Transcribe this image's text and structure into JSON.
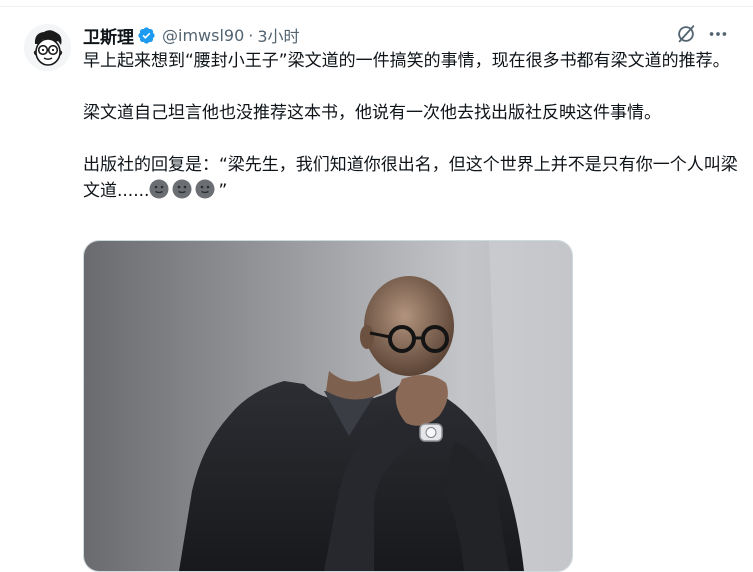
{
  "tweet": {
    "author": {
      "display_name": "卫斯理",
      "handle": "@imwsl90",
      "verified": true,
      "avatar_icon": "cartoon-face-with-glasses-avatar"
    },
    "separator": "·",
    "time": "3小时",
    "actions": {
      "grok_icon": "grok-slash-circle-icon",
      "more_icon": "ellipsis-icon"
    },
    "paragraphs": [
      "早上起来想到“腰封小王子”梁文道的一件搞笑的事情，现在很多书都有梁文道的推荐。",
      "梁文道自己坦言他也没推荐这本书，他说有一次他去找出版社反映这件事情。",
      "出版社的回复是：“梁先生，我们知道你很出名，但这个世界上并不是只有你一个人叫梁文道......"
    ],
    "paragraph_3_emojis": [
      "neutral-face-emoji",
      "neutral-face-emoji",
      "neutral-face-emoji"
    ],
    "paragraph_3_end": "”",
    "media": {
      "type": "photo",
      "subject": "bald man with round glasses, hand on chin, wearing wristwatch"
    },
    "colors": {
      "verified_blue": "#1d9bf0",
      "secondary_text": "#536471",
      "text": "#0f1419"
    }
  }
}
